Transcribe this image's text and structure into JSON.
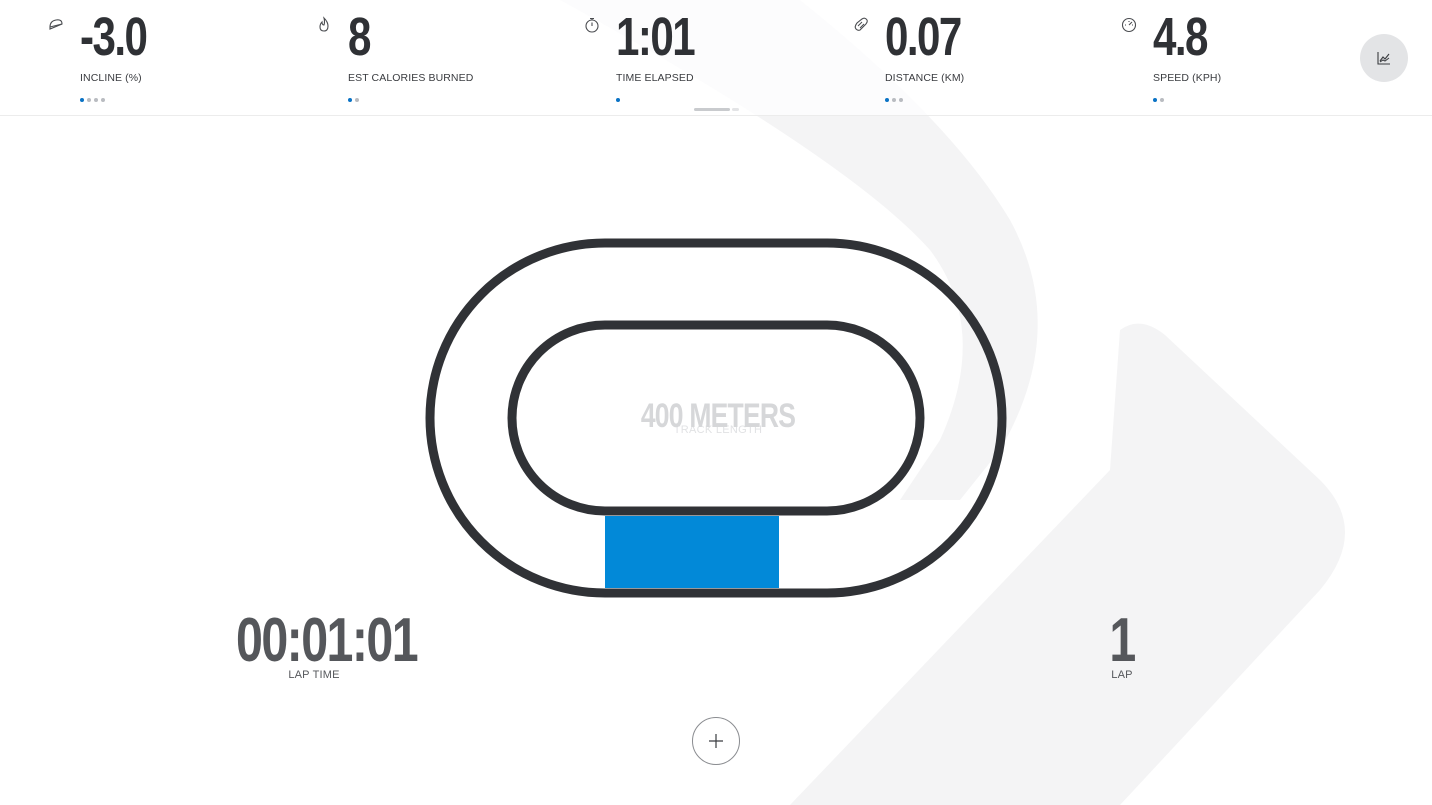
{
  "stats": [
    {
      "icon": "incline-icon",
      "value": "-3.0",
      "label": "INCLINE (%)",
      "dots": 4,
      "active_dot": 0
    },
    {
      "icon": "flame-icon",
      "value": "8",
      "label": "EST CALORIES BURNED",
      "dots": 2,
      "active_dot": 0
    },
    {
      "icon": "stopwatch-icon",
      "value": "1:01",
      "label": "TIME ELAPSED",
      "dots": 1,
      "active_dot": 0
    },
    {
      "icon": "shoe-icon",
      "value": "0.07",
      "label": "DISTANCE (KM)",
      "dots": 3,
      "active_dot": 0
    },
    {
      "icon": "speedometer-icon",
      "value": "4.8",
      "label": "SPEED (KPH)",
      "dots": 2,
      "active_dot": 0
    }
  ],
  "chart_button": {
    "icon": "chart-icon"
  },
  "track": {
    "length_value": "400 METERS",
    "length_label": "TRACK LENGTH",
    "progress_fraction": 0.007
  },
  "lap_time": {
    "value": "00:01:01",
    "label": "LAP TIME"
  },
  "lap": {
    "value": "1",
    "label": "LAP"
  },
  "add_button": {
    "icon": "plus-icon"
  },
  "colors": {
    "accent": "#0289d8",
    "track": "#303236",
    "dot_active": "#0a73c5",
    "dot_inactive": "#b9bcc1"
  }
}
